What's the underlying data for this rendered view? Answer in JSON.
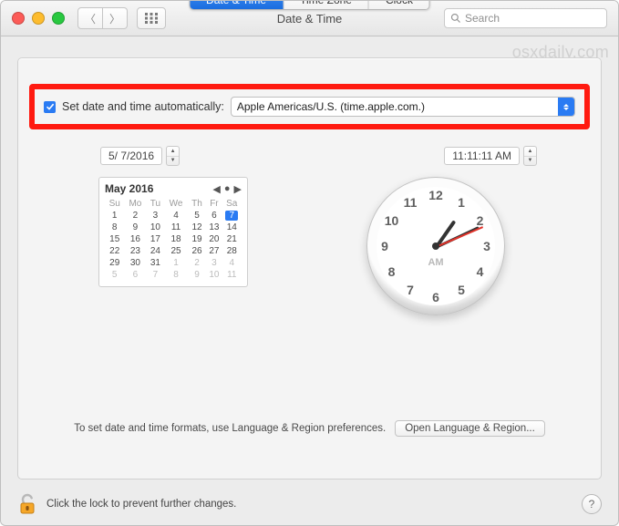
{
  "title": "Date & Time",
  "search_placeholder": "Search",
  "watermark": "osxdaily.com",
  "tabs": [
    "Date & Time",
    "Time Zone",
    "Clock"
  ],
  "auto": {
    "label": "Set date and time automatically:",
    "server": "Apple Americas/U.S. (time.apple.com.)",
    "checked": true
  },
  "date_field": "5/  7/2016",
  "time_field": "11:11:11 AM",
  "calendar": {
    "month": "May 2016",
    "dow": [
      "Su",
      "Mo",
      "Tu",
      "We",
      "Th",
      "Fr",
      "Sa"
    ],
    "rows": [
      [
        {
          "d": 1
        },
        {
          "d": 2
        },
        {
          "d": 3
        },
        {
          "d": 4
        },
        {
          "d": 5
        },
        {
          "d": 6
        },
        {
          "d": 7,
          "sel": true
        }
      ],
      [
        {
          "d": 8
        },
        {
          "d": 9
        },
        {
          "d": 10
        },
        {
          "d": 11
        },
        {
          "d": 12
        },
        {
          "d": 13
        },
        {
          "d": 14
        }
      ],
      [
        {
          "d": 15
        },
        {
          "d": 16
        },
        {
          "d": 17
        },
        {
          "d": 18
        },
        {
          "d": 19
        },
        {
          "d": 20
        },
        {
          "d": 21
        }
      ],
      [
        {
          "d": 22
        },
        {
          "d": 23
        },
        {
          "d": 24
        },
        {
          "d": 25
        },
        {
          "d": 26
        },
        {
          "d": 27
        },
        {
          "d": 28
        }
      ],
      [
        {
          "d": 29
        },
        {
          "d": 30
        },
        {
          "d": 31
        },
        {
          "d": 1,
          "dim": true
        },
        {
          "d": 2,
          "dim": true
        },
        {
          "d": 3,
          "dim": true
        },
        {
          "d": 4,
          "dim": true
        }
      ],
      [
        {
          "d": 5,
          "dim": true
        },
        {
          "d": 6,
          "dim": true
        },
        {
          "d": 7,
          "dim": true
        },
        {
          "d": 8,
          "dim": true
        },
        {
          "d": 9,
          "dim": true
        },
        {
          "d": 10,
          "dim": true
        },
        {
          "d": 11,
          "dim": true
        }
      ]
    ]
  },
  "clock": {
    "ampm": "AM",
    "numbers": [
      "12",
      "1",
      "2",
      "3",
      "4",
      "5",
      "6",
      "7",
      "8",
      "9",
      "10",
      "11"
    ],
    "hour_angle": -55,
    "minute_angle": -25,
    "second_angle": -23
  },
  "footer_text": "To set date and time formats, use Language & Region preferences.",
  "footer_button": "Open Language & Region...",
  "lock_text": "Click the lock to prevent further changes.",
  "help": "?"
}
